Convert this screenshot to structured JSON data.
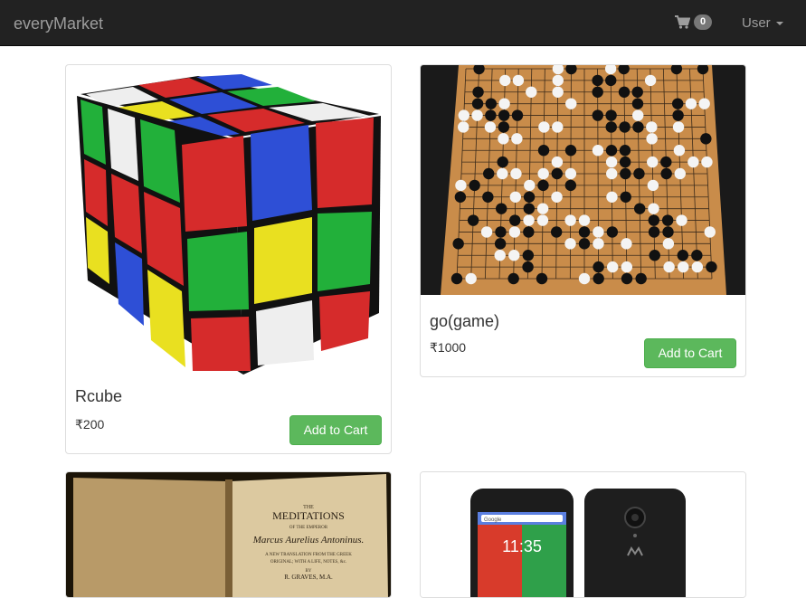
{
  "navbar": {
    "brand": "everyMarket",
    "cart_count": "0",
    "user_label": "User"
  },
  "products": [
    {
      "name": "Rcube",
      "price": "₹200",
      "button": "Add to Cart"
    },
    {
      "name": "go(game)",
      "price": "₹1000",
      "button": "Add to Cart"
    }
  ],
  "book": {
    "lines": [
      "THE",
      "MEDITATIONS",
      "OF THE EMPEROR",
      "Marcus Aurelius Antoninus.",
      "A NEW TRANSLATION FROM THE GREEK",
      "ORIGINAL; WITH A LIFE, NOTES, &c.",
      "BY",
      "R. GRAVES, M.A."
    ]
  },
  "phone": {
    "time": "11:35",
    "search": "Google"
  },
  "colors": {
    "navbar": "#222222",
    "button": "#5cb85c"
  }
}
